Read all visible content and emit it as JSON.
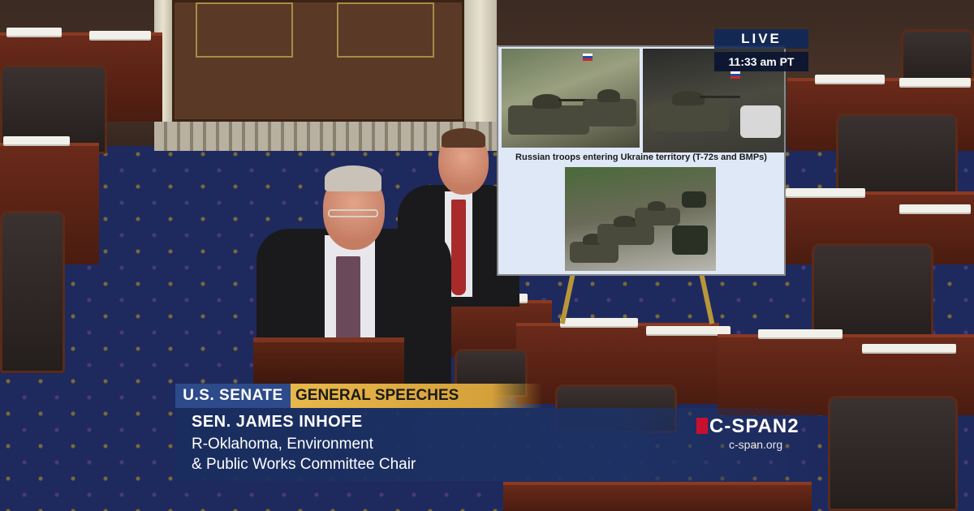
{
  "live_bug": {
    "status": "LIVE",
    "time": "11:33 am PT"
  },
  "poster": {
    "caption": "Russian troops entering Ukraine territory (T-72s and BMPs)"
  },
  "lower_third": {
    "chamber": "U.S. SENATE",
    "program": "GENERAL SPEECHES",
    "speaker_name": "SEN. JAMES INHOFE",
    "speaker_line1": "R-Oklahoma, Environment",
    "speaker_line2": "& Public Works Committee Chair"
  },
  "network": {
    "logo": "C-SPAN2",
    "url": "c-span.org",
    "brand_color": "#c8102e"
  },
  "colors": {
    "senate_tag": "#2d4a8a",
    "program_tag": "#e8b84a",
    "panel": "#1e3264"
  }
}
